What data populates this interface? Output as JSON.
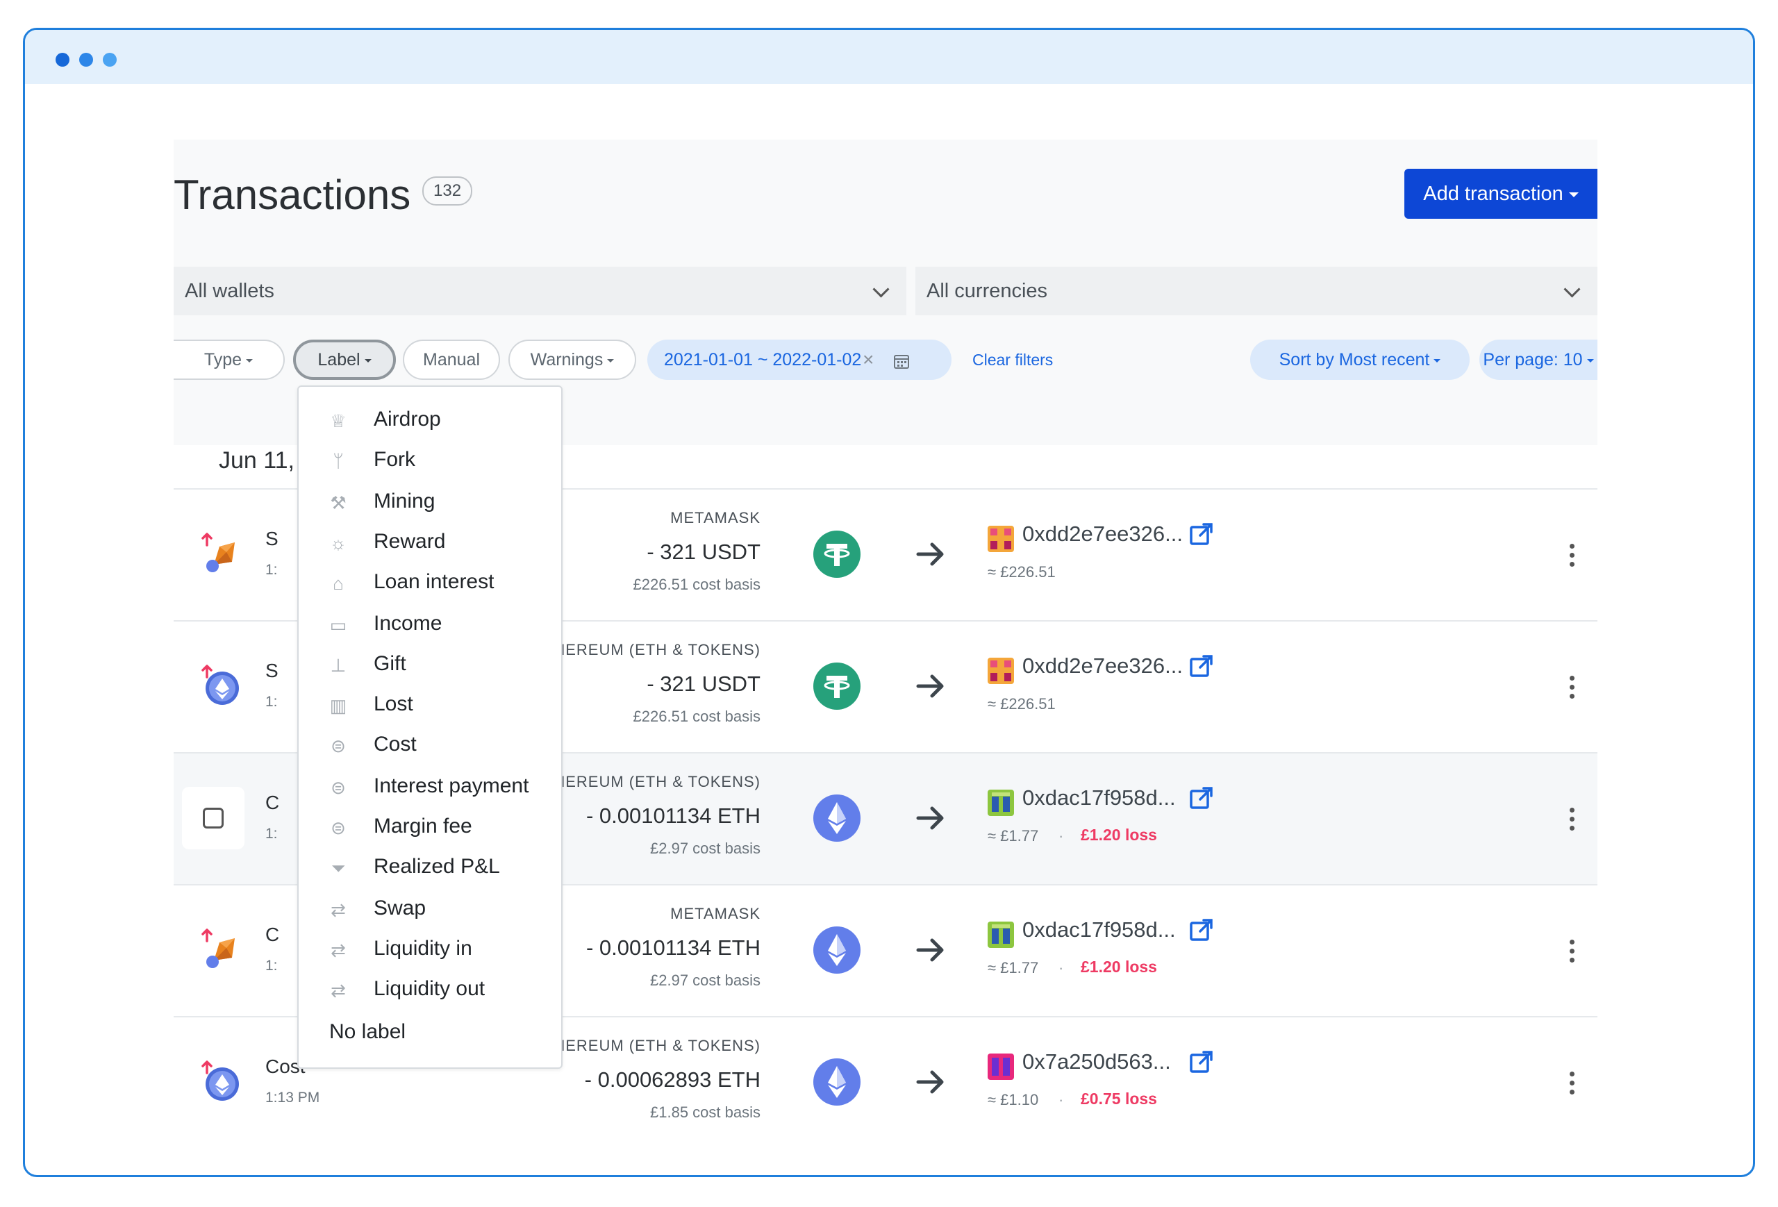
{
  "page": {
    "title": "Transactions",
    "count": "132",
    "add_button": "Add transaction"
  },
  "filters": {
    "wallets": "All wallets",
    "currencies": "All currencies",
    "type": "Type",
    "label": "Label",
    "manual": "Manual",
    "warnings": "Warnings",
    "date_range": "2021-01-01 ~ 2022-01-02",
    "clear": "Clear filters",
    "sort": "Sort by Most recent",
    "per_page": "Per page: 10"
  },
  "date_group": "Jun 11,",
  "label_menu": {
    "items": [
      {
        "label": "Airdrop",
        "icon": "trophy-icon"
      },
      {
        "label": "Fork",
        "icon": "fork-icon"
      },
      {
        "label": "Mining",
        "icon": "pickaxe-icon"
      },
      {
        "label": "Reward",
        "icon": "reward-icon"
      },
      {
        "label": "Loan interest",
        "icon": "bank-icon"
      },
      {
        "label": "Income",
        "icon": "money-icon"
      },
      {
        "label": "Gift",
        "icon": "gift-icon"
      },
      {
        "label": "Lost",
        "icon": "trash-icon"
      },
      {
        "label": "Cost",
        "icon": "coins-icon"
      },
      {
        "label": "Interest payment",
        "icon": "coins-icon"
      },
      {
        "label": "Margin fee",
        "icon": "coins-icon"
      },
      {
        "label": "Realized P&L",
        "icon": "filter-icon"
      },
      {
        "label": "Swap",
        "icon": "swap-icon"
      },
      {
        "label": "Liquidity in",
        "icon": "swap-icon"
      },
      {
        "label": "Liquidity out",
        "icon": "swap-icon"
      }
    ],
    "no_label": "No label"
  },
  "transactions": [
    {
      "type": "S",
      "time": "1:",
      "source": "METAMASK",
      "amount": "- 321 USDT",
      "basis": "£226.51 cost basis",
      "coin": "usdt",
      "dest": "0xdd2e7ee326...",
      "approx": "≈ £226.51",
      "loss": ""
    },
    {
      "type": "S",
      "time": "1:",
      "source": "ETHEREUM (ETH & TOKENS)",
      "amount": "- 321 USDT",
      "basis": "£226.51 cost basis",
      "coin": "usdt",
      "dest": "0xdd2e7ee326...",
      "approx": "≈ £226.51",
      "loss": ""
    },
    {
      "type": "C",
      "time": "1:",
      "source": "ETHEREUM (ETH & TOKENS)",
      "amount": "- 0.00101134 ETH",
      "basis": "£2.97 cost basis",
      "coin": "eth",
      "dest": "0xdac17f958d...",
      "approx": "≈ £1.77",
      "sep": "·",
      "loss": "£1.20 loss"
    },
    {
      "type": "C",
      "time": "1:",
      "source": "METAMASK",
      "amount": "- 0.00101134 ETH",
      "basis": "£2.97 cost basis",
      "coin": "eth",
      "dest": "0xdac17f958d...",
      "approx": "≈ £1.77",
      "sep": "·",
      "loss": "£1.20 loss"
    },
    {
      "type": "Cost",
      "time": "1:13 PM",
      "source": "ETHEREUM (ETH & TOKENS)",
      "amount": "- 0.00062893 ETH",
      "basis": "£1.85 cost basis",
      "coin": "eth",
      "dest": "0x7a250d563...",
      "approx": "≈ £1.10",
      "sep": "·",
      "loss": "£0.75 loss"
    }
  ],
  "colors": {
    "accent": "#0d47d6",
    "link": "#1a66e0",
    "loss": "#ee3a63",
    "usdt": "#26a17b",
    "eth": "#627eea"
  }
}
